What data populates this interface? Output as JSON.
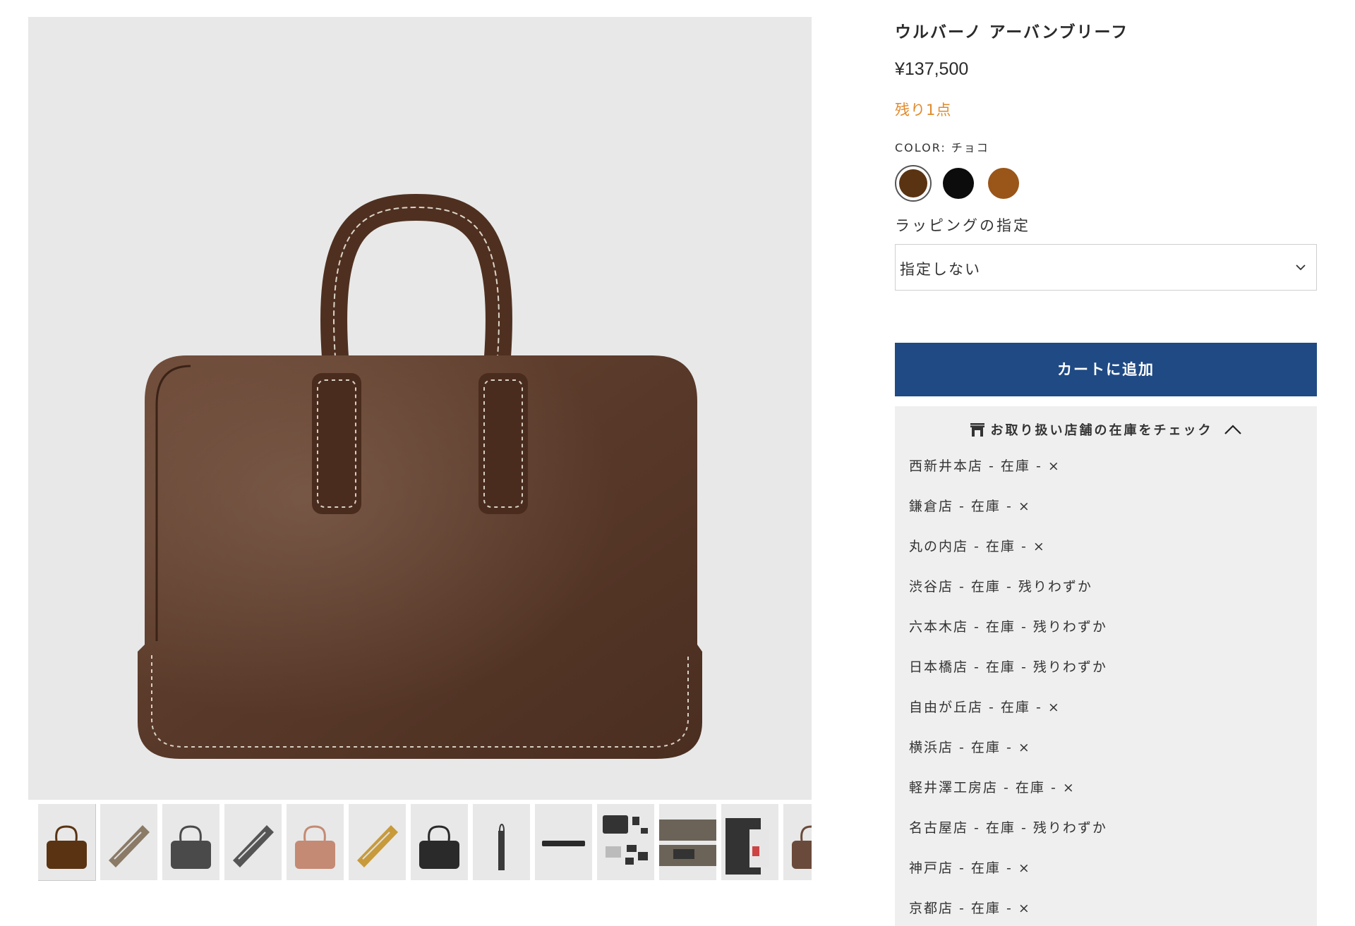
{
  "product": {
    "title": "ウルバーノ アーバンブリーフ",
    "price": "¥137,500",
    "stock_note": "残り1点",
    "color_label": "COLOR: チョコ"
  },
  "colors": [
    {
      "name": "チョコ",
      "hex": "#5a3312",
      "selected": true
    },
    {
      "name": "ブラック",
      "hex": "#0c0c0c",
      "selected": false
    },
    {
      "name": "キャメル",
      "hex": "#9a5519",
      "selected": false
    }
  ],
  "wrapping": {
    "label": "ラッピングの指定",
    "selected": "指定しない"
  },
  "cart": {
    "button_label": "カートに追加"
  },
  "store_stock": {
    "header": "お取り扱い店舗の在庫をチェック",
    "items": [
      "西新井本店 - 在庫 - ×",
      "鎌倉店 - 在庫 - ×",
      "丸の内店 - 在庫 - ×",
      "渋谷店 - 在庫 - 残りわずか",
      "六本木店 - 在庫 - 残りわずか",
      "日本橋店 - 在庫 - 残りわずか",
      "自由が丘店 - 在庫 - ×",
      "横浜店 - 在庫 - ×",
      "軽井澤工房店 - 在庫 - ×",
      "名古屋店 - 在庫 - 残りわずか",
      "神戸店 - 在庫 - ×",
      "京都店 - 在庫 - ×"
    ]
  },
  "gallery": {
    "thumbnails": [
      {
        "kind": "bag-front",
        "color": "#5a3312"
      },
      {
        "kind": "bag-open",
        "color": "#8a7a66"
      },
      {
        "kind": "bag-front",
        "color": "#4a4a4a"
      },
      {
        "kind": "bag-open",
        "color": "#555555"
      },
      {
        "kind": "bag-front",
        "color": "#c48a74"
      },
      {
        "kind": "bag-open",
        "color": "#c89a3a"
      },
      {
        "kind": "bag-front",
        "color": "#2a2a2a"
      },
      {
        "kind": "bag-side",
        "color": "#3a3a3a"
      },
      {
        "kind": "bag-bottom",
        "color": "#2a2a2a"
      },
      {
        "kind": "bag-items",
        "color": "#333333"
      },
      {
        "kind": "bag-interior",
        "color": "#6b6358"
      },
      {
        "kind": "bag-model",
        "color": "#333333"
      },
      {
        "kind": "bag-front",
        "color": "#6a4a3a"
      }
    ]
  }
}
